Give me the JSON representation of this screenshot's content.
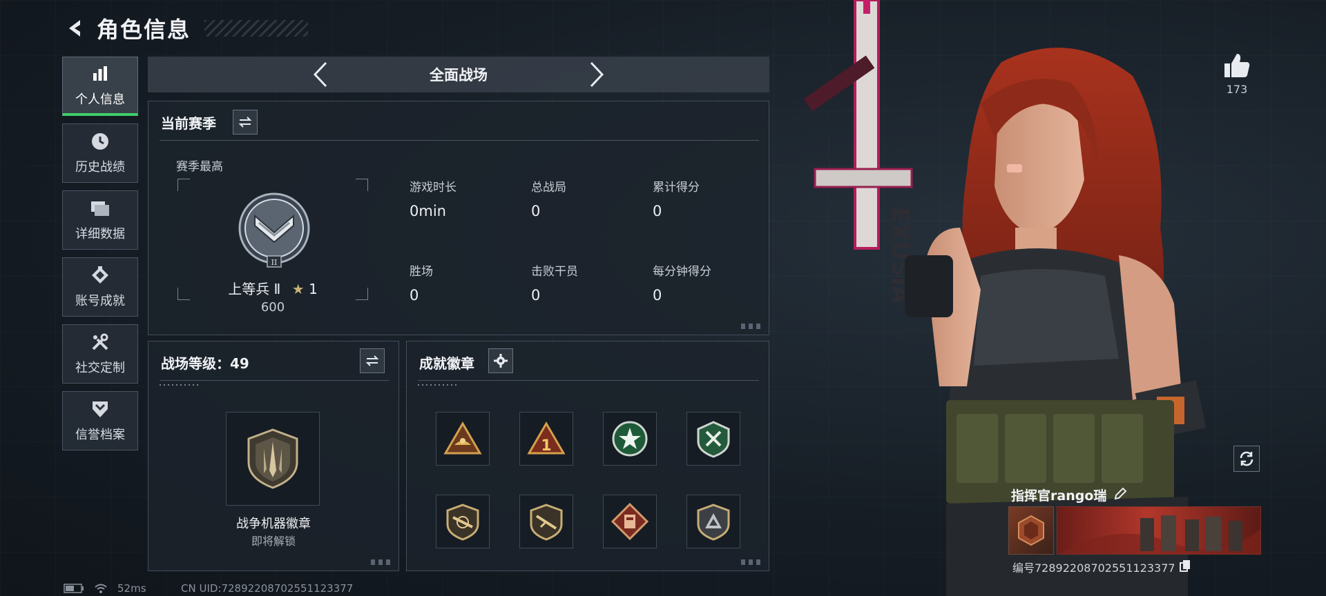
{
  "header": {
    "title": "角色信息"
  },
  "sidebar": {
    "items": [
      {
        "label": "个人信息",
        "icon": "bar-chart-icon",
        "active": true
      },
      {
        "label": "历史战绩",
        "icon": "clock-icon"
      },
      {
        "label": "详细数据",
        "icon": "folder-icon"
      },
      {
        "label": "账号成就",
        "icon": "achievement-icon"
      },
      {
        "label": "社交定制",
        "icon": "tools-icon"
      },
      {
        "label": "信誉档案",
        "icon": "shield-rank-icon"
      }
    ]
  },
  "mode": {
    "label": "全面战场"
  },
  "season": {
    "title": "当前赛季",
    "best_label": "赛季最高",
    "rank_name": "上等兵 Ⅱ",
    "rank_stars": "1",
    "rank_score": "600",
    "stats": [
      {
        "label": "游戏时长",
        "value": "0min"
      },
      {
        "label": "总战局",
        "value": "0"
      },
      {
        "label": "累计得分",
        "value": "0"
      },
      {
        "label": "胜场",
        "value": "0"
      },
      {
        "label": "击败干员",
        "value": "0"
      },
      {
        "label": "每分钟得分",
        "value": "0"
      }
    ]
  },
  "level": {
    "title": "战场等级：49",
    "badge_name": "战争机器徽章",
    "badge_status": "即将解锁"
  },
  "achievements": {
    "title": "成就徽章",
    "badges": [
      "triangle-emblem-icon",
      "triangle-one-icon",
      "green-star-badge-icon",
      "green-cross-badge-icon",
      "shield-rifle-badge-icon",
      "shield-sniper-badge-icon",
      "diamond-vest-badge-icon",
      "grey-triangle-badge-icon"
    ]
  },
  "character": {
    "likes": "173",
    "commander_name": "指挥官rango瑞",
    "id_line": "编号7289220870255112337​7"
  },
  "status": {
    "ping": "52ms",
    "cn_uid": "CN UID:7289220870255112337​7"
  }
}
